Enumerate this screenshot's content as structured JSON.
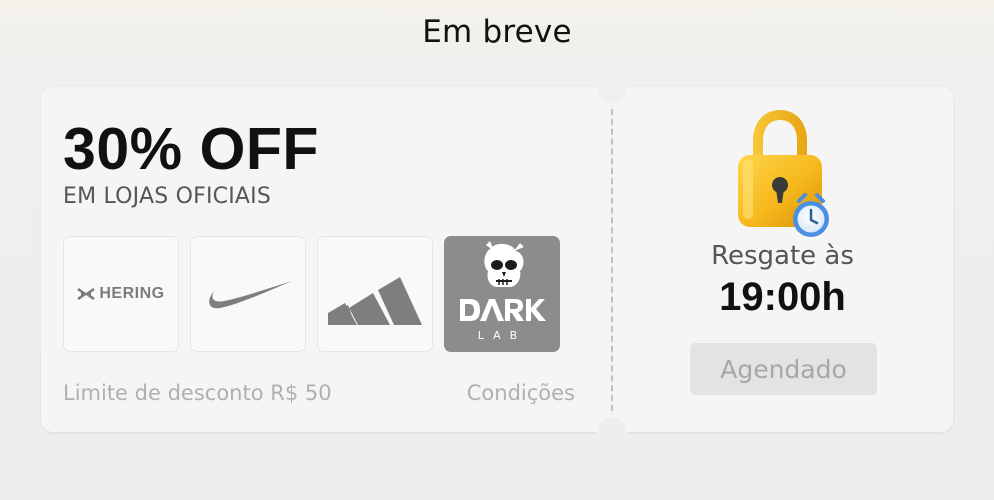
{
  "header": {
    "title": "Em breve"
  },
  "coupon": {
    "discount": "30% OFF",
    "subtitle": "EM LOJAS OFICIAIS",
    "brands": [
      {
        "name": "HERING",
        "icon": "hering-logo"
      },
      {
        "name": "Nike",
        "icon": "nike-swoosh-logo"
      },
      {
        "name": "adidas",
        "icon": "adidas-logo"
      },
      {
        "name": "DARK LAB",
        "icon": "dark-lab-skull-logo"
      }
    ],
    "limit_text": "Limite de desconto R$ 50",
    "conditions_link": "Condições"
  },
  "redeem": {
    "label": "Resgate às",
    "time": "19:00h",
    "button_label": "Agendado",
    "icon": "lock-with-clock-icon"
  },
  "colors": {
    "background": "#eeeeee",
    "card": "#f5f5f5",
    "text_primary": "#111111",
    "text_muted": "#b0b0b0",
    "lock_gold": "#f5b81c"
  }
}
